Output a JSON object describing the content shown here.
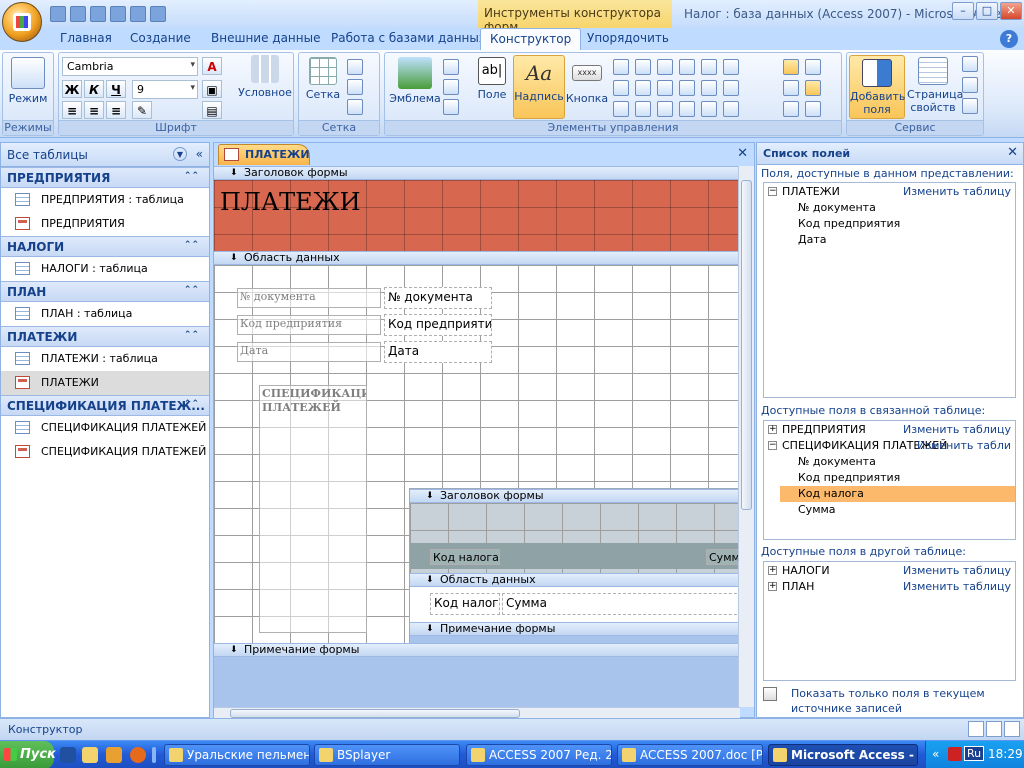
{
  "window": {
    "context_tab": "Инструменты конструктора форм",
    "title": "Налог : база данных (Access 2007) - Microsoft Acce...",
    "btn_min": "–",
    "btn_max": "□",
    "btn_close": "✕"
  },
  "tabs": [
    "Главная",
    "Создание",
    "Внешние данные",
    "Работа с базами данных",
    "Конструктор",
    "Упорядочить"
  ],
  "ribbon": {
    "views": {
      "btn": "Режим",
      "group": "Режимы"
    },
    "font": {
      "name": "Cambria",
      "size": "9",
      "bold": "Ж",
      "italic": "К",
      "underline": "Ч",
      "conditional": "Условное",
      "group": "Шрифт"
    },
    "gridlines": {
      "btn": "Сетка",
      "group": "Сетка"
    },
    "controls": {
      "logo": "Эмблема",
      "field": "Поле",
      "label": "Надпись",
      "button": "Кнопка",
      "field_icon_text": "ab|",
      "label_icon_text": "Aa",
      "button_icon_text": "xxxx",
      "group": "Элементы управления"
    },
    "tools": {
      "add_fields": "Добавить поля",
      "property_sheet": "Страница свойств",
      "group": "Сервис"
    }
  },
  "nav": {
    "header": "Все таблицы",
    "groups": [
      {
        "title": "ПРЕДПРИЯТИЯ",
        "items": [
          {
            "label": "ПРЕДПРИЯТИЯ : таблица",
            "type": "table"
          },
          {
            "label": "ПРЕДПРИЯТИЯ",
            "type": "form"
          }
        ]
      },
      {
        "title": "НАЛОГИ",
        "items": [
          {
            "label": "НАЛОГИ : таблица",
            "type": "table"
          }
        ]
      },
      {
        "title": "ПЛАН",
        "items": [
          {
            "label": "ПЛАН : таблица",
            "type": "table"
          }
        ]
      },
      {
        "title": "ПЛАТЕЖИ",
        "items": [
          {
            "label": "ПЛАТЕЖИ : таблица",
            "type": "table"
          },
          {
            "label": "ПЛАТЕЖИ",
            "type": "form",
            "selected": true
          }
        ]
      },
      {
        "title": "СПЕЦИФИКАЦИЯ ПЛАТЕЖ...",
        "items": [
          {
            "label": "СПЕЦИФИКАЦИЯ ПЛАТЕЖЕЙ ...",
            "type": "table"
          },
          {
            "label": "СПЕЦИФИКАЦИЯ ПЛАТЕЖЕЙ ...",
            "type": "form"
          }
        ]
      }
    ]
  },
  "doc": {
    "tab": "ПЛАТЕЖИ",
    "close": "✕",
    "sections": {
      "header": "Заголовок формы",
      "detail": "Область данных",
      "footer": "Примечание формы"
    },
    "form_title": "ПЛАТЕЖИ",
    "labels": [
      "№ документа",
      "Код предприятия",
      "Дата"
    ],
    "fields": [
      "№ документа",
      "Код предприяти",
      "Дата"
    ],
    "subform_label": "СПЕЦИФИКАЦИЯ ПЛАТЕЖЕЙ",
    "subform": {
      "header": "Заголовок формы",
      "col_labels": [
        "Код налога",
        "Сумм"
      ],
      "detail": "Область данных",
      "fields": [
        "Код налог",
        "Сумма"
      ],
      "footer": "Примечание формы"
    }
  },
  "field_list": {
    "title": "Список полей",
    "close": "✕",
    "cap1": "Поля, доступные в данном представлении:",
    "current": {
      "name": "ПЛАТЕЖИ",
      "link": "Изменить таблицу",
      "fields": [
        "№ документа",
        "Код предприятия",
        "Дата"
      ]
    },
    "cap2": "Доступные поля в связанной таблице:",
    "related": [
      {
        "name": "ПРЕДПРИЯТИЯ",
        "link": "Изменить таблицу"
      },
      {
        "name": "СПЕЦИФИКАЦИЯ ПЛАТЕЖЕЙ",
        "link": "Изменить табли"
      }
    ],
    "related_fields": [
      "№ документа",
      "Код предприятия",
      "Код налога",
      "Сумма"
    ],
    "highlighted": "Код налога",
    "cap3": "Доступные поля в другой таблице:",
    "other": [
      {
        "name": "НАЛОГИ",
        "link": "Изменить таблицу"
      },
      {
        "name": "ПЛАН",
        "link": "Изменить таблицу"
      }
    ],
    "footer": "Показать только поля в текущем источнике записей"
  },
  "status": {
    "text": "Конструктор"
  },
  "taskbar": {
    "start": "Пуск",
    "tasks": [
      "Уральские пельмени ...",
      "BSplayer",
      "ACCESS 2007 Ред. 2012",
      "ACCESS 2007.doc [Ре...",
      "Microsoft Access - ..."
    ],
    "lang": "Ru",
    "clock": "18:29"
  },
  "colors": {
    "form_header": "#d8674f",
    "highlight": "#fdb96b",
    "accent": "#15428b"
  }
}
